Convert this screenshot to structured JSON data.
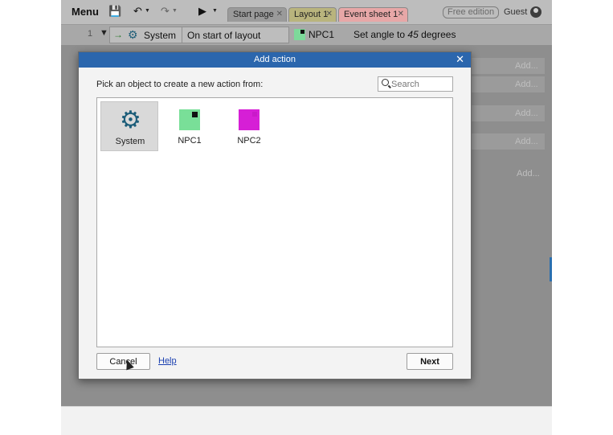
{
  "toolbar": {
    "menu_label": "Menu",
    "tabs": [
      {
        "label": "Start page",
        "color": "#9a9a9a"
      },
      {
        "label": "Layout 1",
        "color": "#b9b47d"
      },
      {
        "label": "Event sheet 1",
        "color": "#e7a7a7"
      }
    ],
    "edition_badge": "Free edition",
    "user_label": "Guest"
  },
  "event_row": {
    "row_number": "1",
    "condition_object": "System",
    "condition_text": "On start of layout",
    "action_object": "NPC1",
    "action_text_prefix": "Set angle to ",
    "action_value": "45",
    "action_text_suffix": " degrees"
  },
  "background_add_labels": [
    "Add...",
    "Add...",
    "Add...",
    "Add...",
    "Add..."
  ],
  "dialog": {
    "title": "Add action",
    "close_glyph": "✕",
    "prompt": "Pick an object to create a new action from:",
    "search_placeholder": "Search",
    "objects": [
      {
        "label": "System",
        "icon": "gear-icon",
        "selected": true
      },
      {
        "label": "NPC1",
        "icon": "npc1-sprite-icon",
        "color": "#79df98"
      },
      {
        "label": "NPC2",
        "icon": "npc2-sprite-icon",
        "color": "#d61fd6"
      }
    ],
    "cancel_label": "Cancel",
    "help_label": "Help",
    "next_label": "Next"
  },
  "colors": {
    "dialog_title_bar": "#2b66ad",
    "link": "#1a3fb0"
  }
}
